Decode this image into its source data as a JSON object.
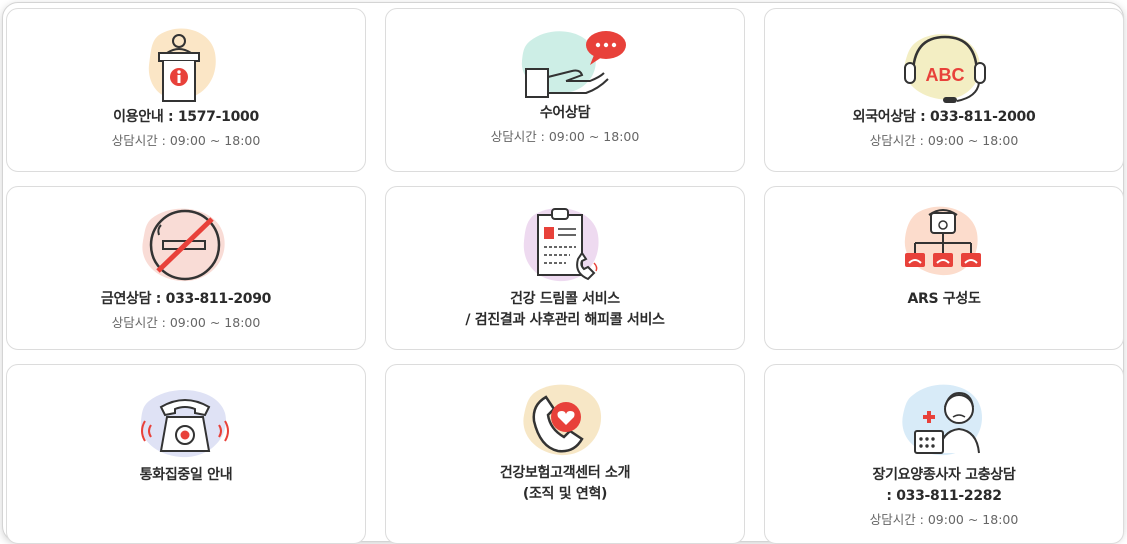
{
  "cards": [
    {
      "title": "이용안내 : 1577-1000",
      "sub": "상담시간 : 09:00 ~ 18:00"
    },
    {
      "title": "수어상담",
      "sub": "상담시간 : 09:00 ~ 18:00"
    },
    {
      "title": "외국어상담 : 033-811-2000",
      "sub": "상담시간 : 09:00 ~ 18:00",
      "icon_text": "ABC"
    },
    {
      "title": "금연상담 : 033-811-2090",
      "sub": "상담시간 : 09:00 ~ 18:00"
    },
    {
      "title_line1": "건강 드림콜 서비스",
      "title_line2": "/ 검진결과 사후관리 해피콜 서비스"
    },
    {
      "title": "ARS 구성도"
    },
    {
      "title": "통화집중일 안내"
    },
    {
      "title_line1": "건강보험고객센터 소개",
      "title_line2": "(조직 및 연혁)"
    },
    {
      "title_line1": "장기요양종사자 고충상담",
      "title_line2": ": 033-811-2282",
      "sub": "상담시간 : 09:00 ~ 18:00"
    }
  ],
  "colors": {
    "accent": "#e8413a",
    "dark": "#333333"
  }
}
